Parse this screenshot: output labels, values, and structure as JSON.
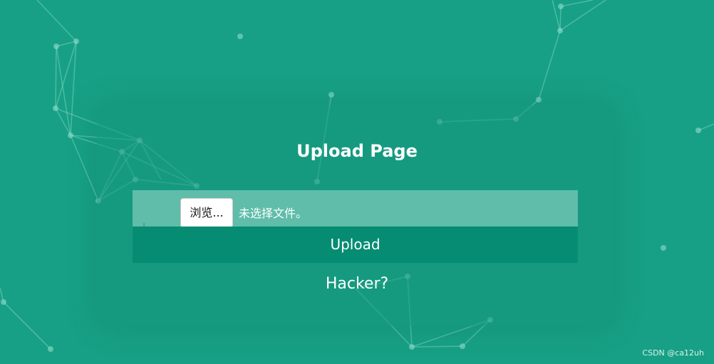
{
  "page": {
    "title": "Upload Page",
    "hacker_text": "Hacker?"
  },
  "file_input": {
    "browse_label": "浏览...",
    "status_text": "未选择文件。"
  },
  "upload_button": {
    "label": "Upload"
  },
  "watermark": {
    "text": "CSDN @ca12uh"
  },
  "colors": {
    "background": "#17a085",
    "file_row": "#5fbdaa",
    "upload_button": "#058c72",
    "network": "#7dd3c0"
  }
}
